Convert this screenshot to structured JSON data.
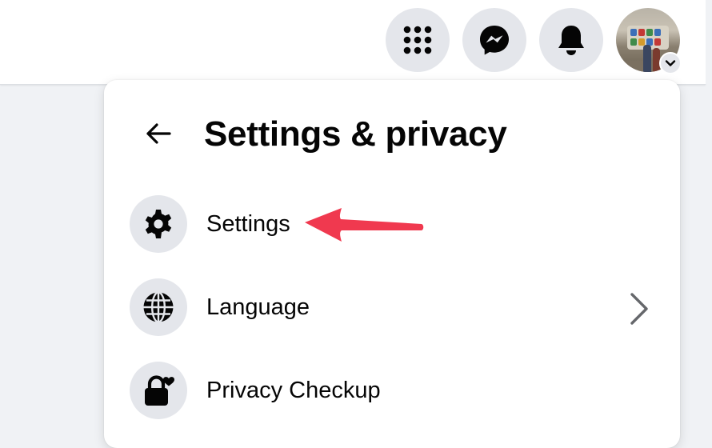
{
  "header": {
    "buttons": [
      {
        "icon": "apps-grid-icon"
      },
      {
        "icon": "messenger-icon"
      },
      {
        "icon": "bell-icon"
      }
    ],
    "profile": {
      "icon": "account-chevron-down-icon"
    }
  },
  "menu": {
    "title": "Settings & privacy",
    "back_icon": "back-arrow-icon",
    "items": [
      {
        "label": "Settings",
        "icon": "gear-icon",
        "has_submenu": false
      },
      {
        "label": "Language",
        "icon": "globe-icon",
        "has_submenu": true
      },
      {
        "label": "Privacy Checkup",
        "icon": "lock-heart-icon",
        "has_submenu": false
      }
    ]
  },
  "annotation": {
    "type": "red-arrow",
    "target": "Settings",
    "color": "#f0394f"
  },
  "colors": {
    "icon_bg": "#e4e6eb",
    "text_primary": "#050505",
    "page_bg": "#f0f2f5",
    "chevron": "#65676b"
  }
}
